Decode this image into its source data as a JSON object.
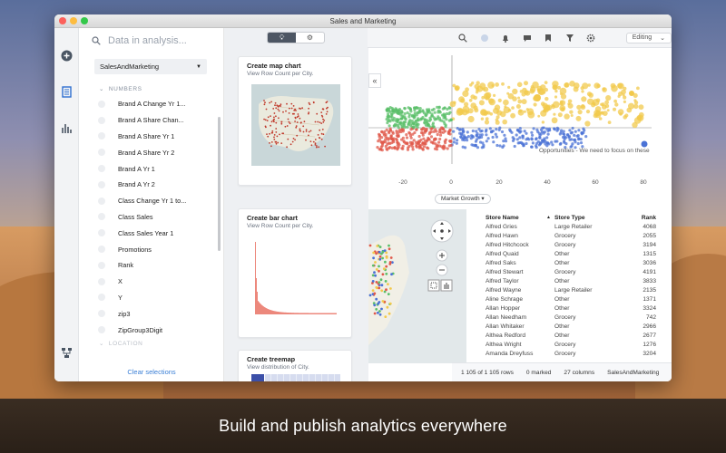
{
  "window": {
    "title": "Sales and Marketing"
  },
  "search": {
    "placeholder": "Data in analysis..."
  },
  "data_table_select": "SalesAndMarketing",
  "sections": {
    "numbers": "NUMBERS",
    "location": "LOCATION"
  },
  "fields": [
    "Brand A Change Yr 1...",
    "Brand A Share Chan...",
    "Brand A Share Yr 1",
    "Brand A Share Yr 2",
    "Brand A Yr 1",
    "Brand A Yr 2",
    "Class Change Yr 1 to...",
    "Class Sales",
    "Class Sales Year 1",
    "Promotions",
    "Rank",
    "X",
    "Y",
    "zip3",
    "ZipGroup3Digit"
  ],
  "clear_selections": "Clear selections",
  "toolbar": {
    "mode": "Editing"
  },
  "recommendations": [
    {
      "title": "Create map chart",
      "subtitle": "View Row Count per City."
    },
    {
      "title": "Create bar chart",
      "subtitle": "View Row Count per City."
    },
    {
      "title": "Create treemap",
      "subtitle": "View distribution of City."
    }
  ],
  "scatter": {
    "annotation": "Opportunities - We need to focus on these",
    "x_ticks": [
      "-20",
      "0",
      "20",
      "40",
      "60",
      "80"
    ],
    "x_axis_selector": "Market Growth"
  },
  "table": {
    "headers": [
      "Store Name",
      "Store Type",
      "Rank"
    ],
    "rows": [
      [
        "Alfred Gries",
        "Large Retailer",
        "4068"
      ],
      [
        "Alfred Hawn",
        "Grocery",
        "2055"
      ],
      [
        "Alfred Hitchcock",
        "Grocery",
        "3194"
      ],
      [
        "Alfred Quaid",
        "Other",
        "1315"
      ],
      [
        "Alfred Saks",
        "Other",
        "3036"
      ],
      [
        "Alfred Stewart",
        "Grocery",
        "4191"
      ],
      [
        "Alfred Taylor",
        "Other",
        "3833"
      ],
      [
        "Alfred Wayne",
        "Large Retailer",
        "2135"
      ],
      [
        "Aline Schrage",
        "Other",
        "1371"
      ],
      [
        "Allan Hopper",
        "Other",
        "3324"
      ],
      [
        "Allan Needham",
        "Grocery",
        "742"
      ],
      [
        "Allan Whitaker",
        "Other",
        "2966"
      ],
      [
        "Althea Redford",
        "Other",
        "2677"
      ],
      [
        "Althea Wright",
        "Grocery",
        "1276"
      ],
      [
        "Amanda Dreyfuss",
        "Grocery",
        "3204"
      ]
    ]
  },
  "status": {
    "rows": "1 105 of 1 105 rows",
    "marked": "0 marked",
    "columns": "27 columns",
    "source": "SalesAndMarketing"
  },
  "tagline": "Build and publish analytics everywhere",
  "colors": {
    "accent": "#3a7fd6",
    "red": "#e0584a",
    "green": "#5bbf6a",
    "yellow": "#f2c94c",
    "blue": "#4a72d6",
    "gray": "#9aa2ad"
  }
}
